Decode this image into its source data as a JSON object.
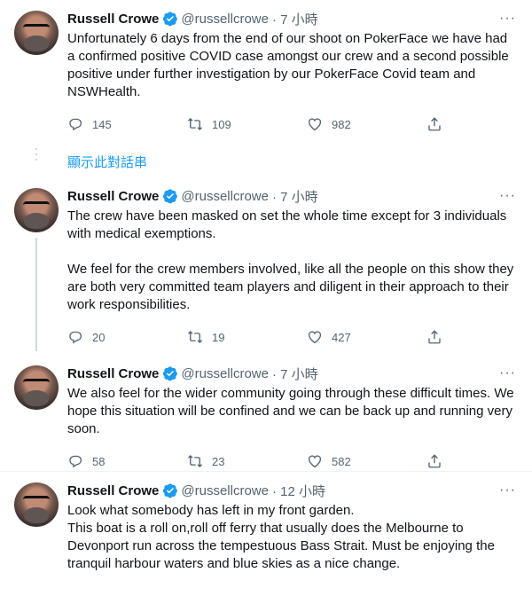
{
  "show_thread": "顯示此對話串",
  "tweets": [
    {
      "name": "Russell Crowe",
      "handle": "@russellcrowe",
      "time": "· 7 小時",
      "text": "Unfortunately 6 days from the end of our shoot on PokerFace we have had a confirmed positive COVID case amongst our crew and a second possible positive under further investigation by our PokerFace Covid team and NSWHealth.",
      "replies": "145",
      "retweets": "109",
      "likes": "982"
    },
    {
      "name": "Russell Crowe",
      "handle": "@russellcrowe",
      "time": "· 7 小時",
      "text": "The crew have been masked on set the whole time except for 3 individuals with medical exemptions.\n\nWe feel for the crew members involved, like all the people on this show they are both very committed team players and diligent in their approach to their work responsibilities.",
      "replies": "20",
      "retweets": "19",
      "likes": "427"
    },
    {
      "name": "Russell Crowe",
      "handle": "@russellcrowe",
      "time": "· 7 小時",
      "text": "We also feel for the wider community going through these difficult times. We hope this situation will be confined and we can be back up and running very soon.",
      "replies": "58",
      "retweets": "23",
      "likes": "582"
    },
    {
      "name": "Russell Crowe",
      "handle": "@russellcrowe",
      "time": "· 12 小時",
      "text": "Look what somebody has left in my front garden.\nThis boat is a roll on,roll off ferry that usually does the Melbourne to Devonport run across the tempestuous Bass Strait. Must be enjoying the tranquil harbour waters and blue skies as a nice change."
    }
  ]
}
